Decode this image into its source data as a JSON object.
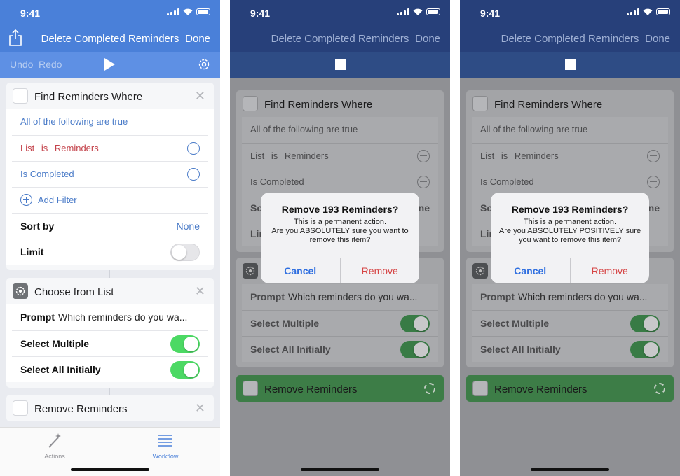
{
  "status": {
    "time": "9:41"
  },
  "nav": {
    "title": "Delete Completed Reminders",
    "done": "Done"
  },
  "toolbar": {
    "undo": "Undo",
    "redo": "Redo"
  },
  "find": {
    "title": "Find Reminders Where",
    "condition": "All of the following are true",
    "filter1": {
      "field": "List",
      "op": "is",
      "value": "Reminders"
    },
    "filter2": {
      "field": "Is Completed"
    },
    "add_filter": "Add Filter",
    "sort_by": "Sort by",
    "sort_value": "None",
    "limit": "Limit",
    "limit_on": false
  },
  "choose": {
    "title": "Choose from List",
    "prompt_label": "Prompt",
    "prompt_value": "Which reminders do you wa...",
    "select_multiple": "Select Multiple",
    "select_multiple_on": true,
    "select_all": "Select All Initially",
    "select_all_on": true
  },
  "remove": {
    "title": "Remove Reminders"
  },
  "tabs": {
    "actions": "Actions",
    "workflow": "Workflow"
  },
  "alert1": {
    "title": "Remove 193 Reminders?",
    "line1": "This is a permanent action.",
    "line2": "Are you ABSOLUTELY sure you want to",
    "line3": "remove this item?",
    "cancel": "Cancel",
    "remove": "Remove"
  },
  "alert2": {
    "title": "Remove 193 Reminders?",
    "line1": "This is a permanent action.",
    "line2": "Are you ABSOLUTELY POSITIVELY sure",
    "line3": "you want to remove this item?",
    "cancel": "Cancel",
    "remove": "Remove"
  },
  "peek": {
    "sort_fragment": "Sc",
    "sort_tail": "ne",
    "limit_fragment": "Lir"
  },
  "colors": {
    "nav": "#4a80d9",
    "accent": "#4a7bc8",
    "destructive": "#c4444c",
    "toggle_on": "#4cd964"
  }
}
